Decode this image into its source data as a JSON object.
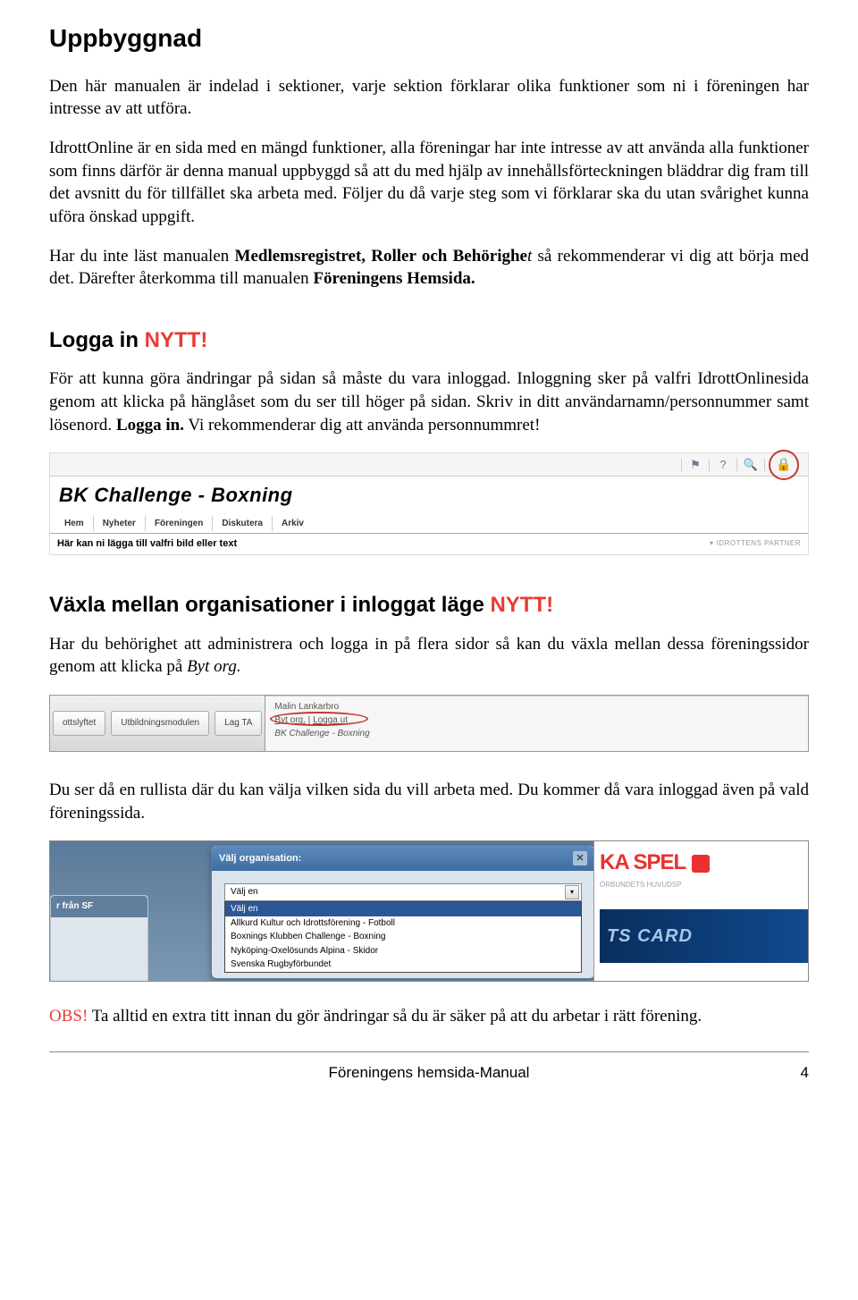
{
  "section1": {
    "heading": "Uppbyggnad",
    "p1": "Den här manualen är indelad i sektioner, varje sektion förklarar olika funktioner som ni i föreningen har intresse av att utföra.",
    "p2": "IdrottOnline är en sida med en mängd funktioner, alla föreningar har inte intresse av att använda alla funktioner som finns därför är denna manual uppbyggd så att du med hjälp av innehållsförteckningen bläddrar dig fram till det avsnitt du för tillfället ska arbeta med. Följer du då varje steg som vi förklarar ska du utan svårighet kunna uföra önskad uppgift.",
    "p3_a": "Har du inte läst manualen ",
    "p3_b": "Medlemsregistret, Roller och Behörighe",
    "p3_c": "t",
    "p3_d": " så rekommenderar vi dig att börja med det. Därefter återkomma till manualen ",
    "p3_e": "Föreningens Hemsida."
  },
  "section2": {
    "heading_a": "Logga in ",
    "heading_b": "NYTT!",
    "p1_a": "För att kunna göra ändringar på sidan så måste du vara inloggad. Inloggning sker på valfri IdrottOnlinesida genom att klicka på hänglåset som du ser till höger på sidan. Skriv in ditt användarnamn/personnummer samt lösenord. ",
    "p1_b": "Logga in.",
    "p1_c": " Vi rekommenderar dig att använda personnummret!"
  },
  "shot1": {
    "title": "BK Challenge - Boxning",
    "nav": [
      "Hem",
      "Nyheter",
      "Föreningen",
      "Diskutera",
      "Arkiv"
    ],
    "subtitle": "Här kan ni lägga till valfri bild eller text",
    "partner": "IDROTTENS PARTNER"
  },
  "section3": {
    "heading_a": "Växla mellan organisationer i inloggat läge ",
    "heading_b": "NYTT!",
    "p1_a": "Har du behörighet att administrera och logga in på flera sidor så kan du växla mellan dessa föreningssidor genom att klicka på ",
    "p1_b": "Byt org."
  },
  "shot2": {
    "tabs": [
      "ottslyftet",
      "Utbildningsmodulen",
      "Lag TA"
    ],
    "user": "Malin Lankarbro",
    "byt": "Byt org.",
    "loggaut": "Logga ut",
    "context": "BK Challenge - Boxning"
  },
  "section4": {
    "p1": "Du ser då en rullista där du kan välja vilken sida du vill arbeta med. Du kommer då vara inloggad även på vald föreningssida."
  },
  "shot3": {
    "left_header": "r från SF",
    "dialog_title": "Välj organisation:",
    "selected": "Välj en",
    "options": [
      "Välj en",
      "Allkurd Kultur och Idrottsförening - Fotboll",
      "Boxnings Klubben Challenge - Boxning",
      "Nyköping-Oxelösunds Alpina - Skidor",
      "Svenska Rugbyförbundet"
    ],
    "right_logo": "KA SPEL",
    "right_sub": "ÖRBUNDETS HUVUDSP",
    "right_card": "TS CARD"
  },
  "section5": {
    "obs": "OBS!",
    "p1": " Ta alltid en extra titt innan du gör ändringar så du är säker på att du arbetar i rätt förening."
  },
  "footer": {
    "title": "Föreningens hemsida-Manual",
    "page": "4"
  }
}
